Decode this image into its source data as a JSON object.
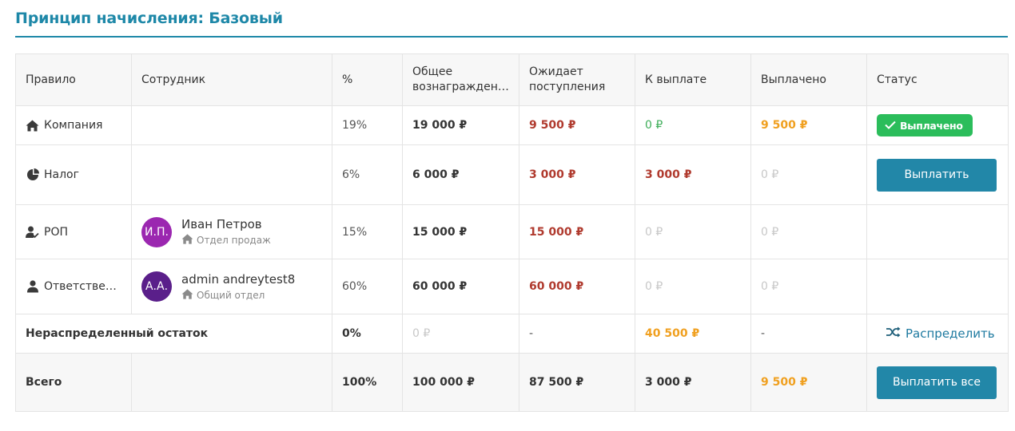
{
  "page": {
    "title": "Принцип начисления: Базовый"
  },
  "colors": {
    "accent": "#1e88a8",
    "button": "#2287a8",
    "success": "#2bbd5b",
    "red": "#b03a2e",
    "green": "#3fae5a",
    "orange": "#f0a020",
    "muted": "#c8c8c8"
  },
  "headers": {
    "rule": "Правило",
    "employee": "Сотрудник",
    "percent": "%",
    "total_l1": "Общее",
    "total_l2": "вознагражден…",
    "pending_l1": "Ожидает",
    "pending_l2": "поступления",
    "to_pay": "К выплате",
    "paid": "Выплачено",
    "status": "Статус"
  },
  "rows": [
    {
      "icon": "home-icon",
      "rule": "Компания",
      "percent": "19%",
      "total": "19 000 ₽",
      "pending": "9 500 ₽",
      "to_pay": "0 ₽",
      "paid": "9 500 ₽",
      "status_badge": "Выплачено"
    },
    {
      "icon": "pie-chart-icon",
      "rule": "Налог",
      "percent": "6%",
      "total": "6 000 ₽",
      "pending": "3 000 ₽",
      "to_pay": "3 000 ₽",
      "paid": "0 ₽",
      "action": "Выплатить"
    },
    {
      "icon": "user-check-icon",
      "rule": "РОП",
      "employee": {
        "initials": "И.П.",
        "avatar_color": "#9b27b0",
        "name": "Иван Петров",
        "dept": "Отдел продаж"
      },
      "percent": "15%",
      "total": "15 000 ₽",
      "pending": "15 000 ₽",
      "to_pay": "0 ₽",
      "paid": "0 ₽"
    },
    {
      "icon": "user-icon",
      "rule": "Ответствен…",
      "employee": {
        "initials": "А.А.",
        "avatar_color": "#5a1f8a",
        "name": "admin andreytest8",
        "dept": "Общий отдел"
      },
      "percent": "60%",
      "total": "60 000 ₽",
      "pending": "60 000 ₽",
      "to_pay": "0 ₽",
      "paid": "0 ₽"
    }
  ],
  "remainder": {
    "label": "Нераспределенный остаток",
    "percent": "0%",
    "total": "0 ₽",
    "pending": "-",
    "to_pay": "40 500 ₽",
    "paid": "-",
    "action": "Распределить"
  },
  "totals": {
    "label": "Всего",
    "percent": "100%",
    "total": "100 000 ₽",
    "pending": "87 500 ₽",
    "to_pay": "3 000 ₽",
    "paid": "9 500 ₽",
    "action": "Выплатить все"
  }
}
